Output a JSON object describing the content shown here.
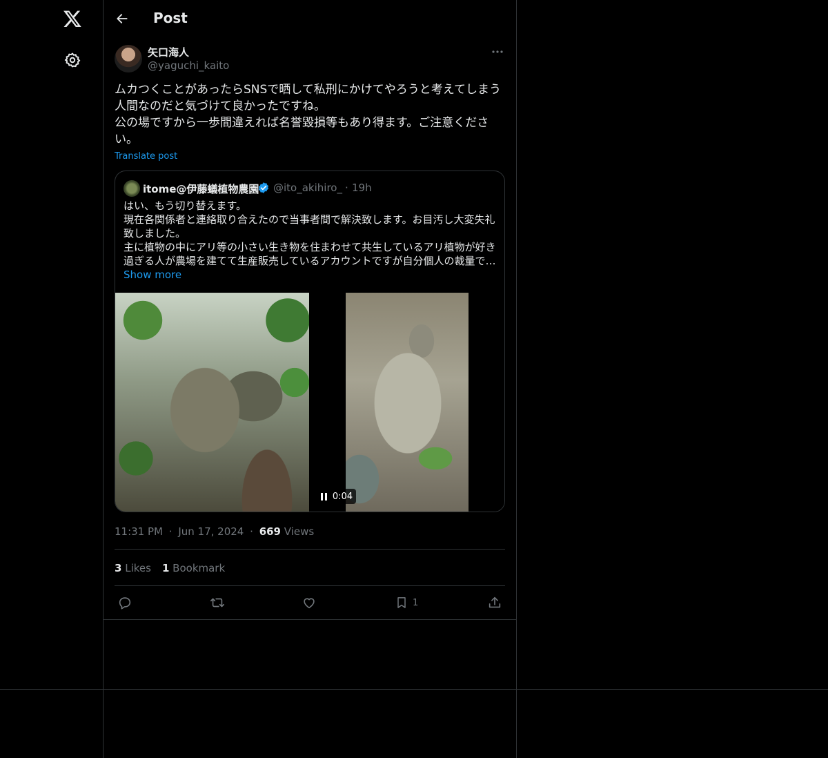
{
  "header": {
    "title": "Post"
  },
  "post": {
    "author_name": "矢口海人",
    "author_handle": "@yaguchi_kaito",
    "text": "ムカつくことがあったらSNSで晒して私刑にかけてやろうと考えてしまう人間なのだと気づけて良かったですね。\n公の場ですから一歩間違えれば名誉毀損等もあり得ます。ご注意ください。",
    "translate_label": "Translate post",
    "time": "11:31 PM",
    "date": "Jun 17, 2024",
    "views_count": "669",
    "views_label": "Views",
    "sep": "·",
    "likes_count": "3",
    "likes_label": "Likes",
    "bookmarks_count": "1",
    "bookmarks_label": "Bookmark",
    "bookmark_action_count": "1"
  },
  "quote": {
    "name": "itome@伊藤蟻植物農園",
    "handle": "@ito_akihiro_",
    "sep": "·",
    "time": "19h",
    "text": "はい、もう切り替えます。\n現在各関係者と連絡取り合えたので当事者間で解決致します。お目汚し大変失礼致しました。\n主に植物の中にアリ等の小さい生き物を住まわせて共生しているアリ植物が好き過ぎる人が農場を建てて生産販売しているアカウントですが自分個人の裁量で…",
    "show_more": "Show more",
    "video_time": "0:04"
  },
  "icons": {
    "logo": "x-logo-icon",
    "settings": "gear-icon",
    "back": "arrow-left-icon",
    "more": "more-horizontal-icon",
    "verified": "verified-badge-icon",
    "pause": "pause-icon",
    "reply": "reply-icon",
    "repost": "repost-icon",
    "like": "heart-icon",
    "bookmark": "bookmark-icon",
    "share": "share-icon"
  },
  "colors": {
    "background": "#000000",
    "text": "#e7e9ea",
    "secondary": "#71767b",
    "accent": "#1d9bf0",
    "border": "#2f3336"
  }
}
